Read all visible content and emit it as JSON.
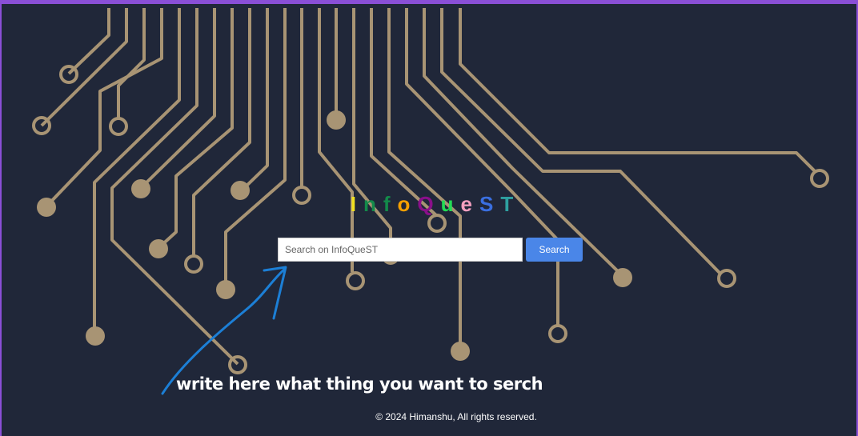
{
  "logo": {
    "letters": [
      {
        "char": "I",
        "color": "#f0e020"
      },
      {
        "char": "n",
        "color": "#138a4a"
      },
      {
        "char": "f",
        "color": "#138a4a"
      },
      {
        "char": "o",
        "color": "#f5a000"
      },
      {
        "char": "Q",
        "color": "#8a0f8a"
      },
      {
        "char": "u",
        "color": "#22dd55"
      },
      {
        "char": "e",
        "color": "#f5a0c0"
      },
      {
        "char": "S",
        "color": "#3a6fe0"
      },
      {
        "char": "T",
        "color": "#2ea0a0"
      }
    ]
  },
  "search": {
    "placeholder": "Search on InfoQueST",
    "value": "",
    "button_label": "Search"
  },
  "annotation": {
    "text": "write here what thing you want to serch",
    "color": "#1c7fd6"
  },
  "footer": {
    "text": "© 2024 Himanshu, All rights reserved."
  },
  "theme": {
    "background": "#202739",
    "circuit_color": "#a89474",
    "frame_color": "#8a4fd6",
    "button_color": "#4a86e8"
  }
}
